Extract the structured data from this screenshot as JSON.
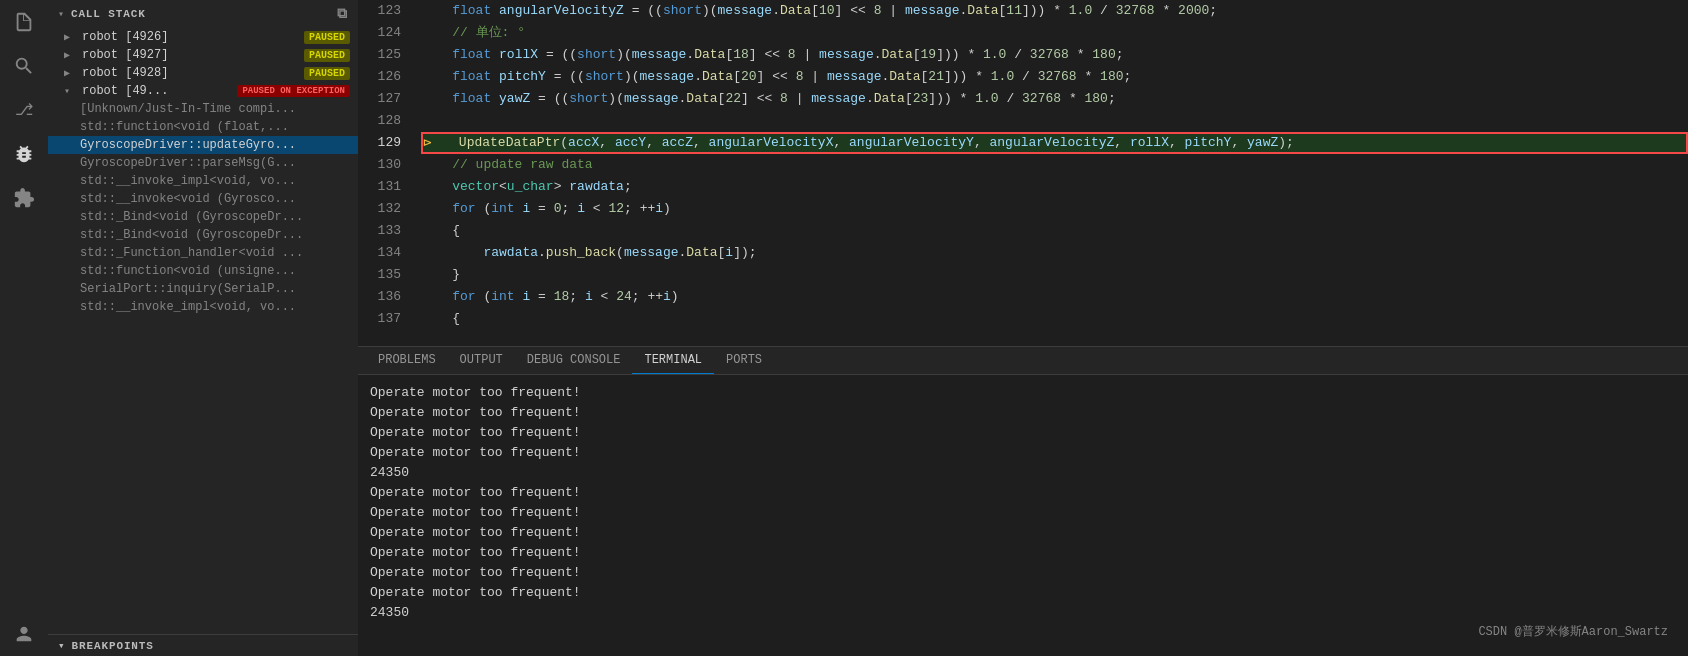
{
  "activityBar": {
    "icons": [
      {
        "name": "files-icon",
        "symbol": "📄",
        "active": false
      },
      {
        "name": "search-icon",
        "symbol": "🔍",
        "active": false
      },
      {
        "name": "git-icon",
        "symbol": "⎇",
        "active": false
      },
      {
        "name": "debug-icon",
        "symbol": "▶",
        "active": true
      },
      {
        "name": "extensions-icon",
        "symbol": "⊞",
        "active": false
      },
      {
        "name": "account-icon",
        "symbol": "👤",
        "active": false
      }
    ]
  },
  "callStack": {
    "sectionLabel": "CALL STACK",
    "threads": [
      {
        "id": "robot-4926",
        "label": "robot [4926]",
        "badge": "PAUSED",
        "badgeType": "paused",
        "expanded": false,
        "frames": []
      },
      {
        "id": "robot-4927",
        "label": "robot [4927]",
        "badge": "PAUSED",
        "badgeType": "paused",
        "expanded": false,
        "frames": []
      },
      {
        "id": "robot-4928",
        "label": "robot [4928]",
        "badge": "PAUSED",
        "badgeType": "paused",
        "expanded": false,
        "frames": []
      },
      {
        "id": "robot-4929",
        "label": "robot [49...",
        "badge": "PAUSED ON EXCEPTION",
        "badgeType": "exception",
        "expanded": true,
        "frames": [
          {
            "label": "[Unknown/Just-In-Time compi...",
            "active": false
          },
          {
            "label": "std::function<void (float,...",
            "active": false
          },
          {
            "label": "GyroscopeDriver::updateGyro...",
            "active": true
          },
          {
            "label": "GyroscopeDriver::parseMsg(G...",
            "active": false
          },
          {
            "label": "std::__invoke_impl<void, vo...",
            "active": false
          },
          {
            "label": "std::__invoke<void (Gyrosco...",
            "active": false
          },
          {
            "label": "std::_Bind<void (GyroscopeDr...",
            "active": false
          },
          {
            "label": "std::_Bind<void (GyroscopeDr...",
            "active": false
          },
          {
            "label": "std::_Function_handler<void ...",
            "active": false
          },
          {
            "label": "std::function<void (unsigne...",
            "active": false
          },
          {
            "label": "SerialPort::inquiry(SerialP...",
            "active": false
          },
          {
            "label": "std::__invoke_impl<void, vo...",
            "active": false
          }
        ]
      }
    ]
  },
  "breakpoints": {
    "sectionLabel": "BREAKPOINTS"
  },
  "codeLines": [
    {
      "num": 123,
      "content": "    float angularVelocityZ = ((short)(message.Data[10] << 8 | message.Data[11])) * 1.0 / 32768 * 2000;",
      "highlight": false,
      "current": false
    },
    {
      "num": 124,
      "content": "    // 单位: °",
      "highlight": false,
      "current": false,
      "isComment": true
    },
    {
      "num": 125,
      "content": "    float rollX = ((short)(message.Data[18] << 8 | message.Data[19])) * 1.0 / 32768 * 180;",
      "highlight": false,
      "current": false
    },
    {
      "num": 126,
      "content": "    float pitchY = ((short)(message.Data[20] << 8 | message.Data[21])) * 1.0 / 32768 * 180;",
      "highlight": false,
      "current": false
    },
    {
      "num": 127,
      "content": "    float yawZ = ((short)(message.Data[22] << 8 | message.Data[23])) * 1.0 / 32768 * 180;",
      "highlight": false,
      "current": false
    },
    {
      "num": 128,
      "content": "",
      "highlight": false,
      "current": false
    },
    {
      "num": 129,
      "content": "    UpdateDataPtr(accX, accY, accZ, angularVelocityX, angularVelocityY, angularVelocityZ, rollX, pitchY, yawZ);",
      "highlight": true,
      "current": true,
      "debugArrow": true
    },
    {
      "num": 130,
      "content": "    // update raw data",
      "highlight": false,
      "current": false,
      "isComment": true
    },
    {
      "num": 131,
      "content": "    vector<u_char> rawdata;",
      "highlight": false,
      "current": false
    },
    {
      "num": 132,
      "content": "    for (int i = 0; i < 12; ++i)",
      "highlight": false,
      "current": false
    },
    {
      "num": 133,
      "content": "    {",
      "highlight": false,
      "current": false
    },
    {
      "num": 134,
      "content": "        rawdata.push_back(message.Data[i]);",
      "highlight": false,
      "current": false
    },
    {
      "num": 135,
      "content": "    }",
      "highlight": false,
      "current": false
    },
    {
      "num": 136,
      "content": "    for (int i = 18; i < 24; ++i)",
      "highlight": false,
      "current": false
    },
    {
      "num": 137,
      "content": "    {",
      "highlight": false,
      "current": false
    }
  ],
  "panelTabs": [
    {
      "label": "PROBLEMS",
      "active": false
    },
    {
      "label": "OUTPUT",
      "active": false
    },
    {
      "label": "DEBUG CONSOLE",
      "active": false
    },
    {
      "label": "TERMINAL",
      "active": true
    },
    {
      "label": "PORTS",
      "active": false
    }
  ],
  "terminalLines": [
    "Operate motor too frequent!",
    "Operate motor too frequent!",
    "Operate motor too frequent!",
    "Operate motor too frequent!",
    "24350",
    "Operate motor too frequent!",
    "Operate motor too frequent!",
    "Operate motor too frequent!",
    "Operate motor too frequent!",
    "Operate motor too frequent!",
    "Operate motor too frequent!",
    "24350"
  ],
  "watermark": "CSDN @普罗米修斯Aaron_Swartz"
}
